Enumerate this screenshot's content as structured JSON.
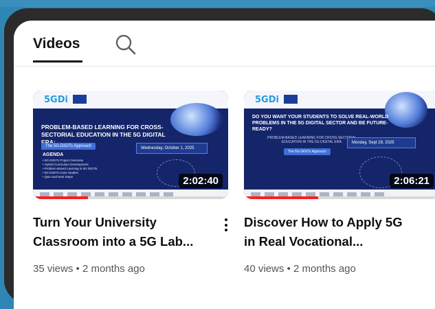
{
  "tabs": {
    "videos_label": "Videos",
    "search_icon": "search-icon"
  },
  "videos": [
    {
      "title_line1": "Turn Your University",
      "title_line2": "Classroom into a 5G Lab...",
      "views": "35 views",
      "age": "2 months ago",
      "duration": "2:02:40",
      "progress_fraction": 0.28,
      "thumbnail": {
        "logo": "5GDi",
        "headline": "PROBLEM-BASED LEARNING FOR CROSS-SECTORIAL EDUCATION IN THE 5G DIGITAL ERA:",
        "subtitle": "The 5G-DiGITs Approach",
        "agenda_title": "AGENDA",
        "agenda_items": "• 5G-DiGITs Project Overview\n• Hybrid Curriculum Development\n• Problem-Based Learning in 5G DiGITs\n• 5G-DiGITs Case Studies\n• Q&A and Next Steps",
        "date": "Wednesday, October 1, 2025"
      }
    },
    {
      "title_line1": "Discover How to Apply 5G",
      "title_line2": "in Real Vocational...",
      "views": "40 views",
      "age": "2 months ago",
      "duration": "2:06:21",
      "progress_fraction": 0.38,
      "thumbnail": {
        "logo": "5GDi",
        "headline": "DO YOU WANT YOUR STUDENTS TO SOLVE REAL-WORLD PROBLEMS IN THE 5G DIGITAL SECTOR AND BE FUTURE-READY?",
        "subtitle": "PROBLEM-BASED LEARNING FOR CROSS-SECTORAL EDUCATION IN THE 5G DIGITAL ERA:",
        "badge": "The 5G-DiGITs Approach",
        "date": "Monday, Sept 29, 2025"
      }
    }
  ],
  "separator": "•"
}
